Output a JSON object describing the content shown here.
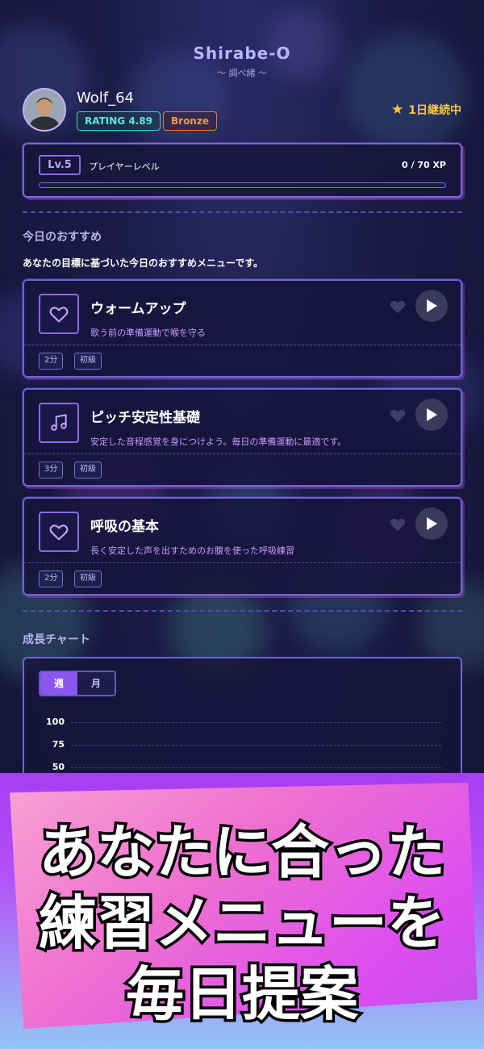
{
  "app": {
    "title": "Shirabe-O",
    "subtitle": "〜 調べ緒 〜"
  },
  "profile": {
    "avatar_icon": "user-avatar",
    "username": "Wolf_64",
    "rating": "RATING 4.89",
    "rank": "Bronze",
    "streak_icon": "star-icon",
    "streak": "1日継続中"
  },
  "level": {
    "badge": "Lv.5",
    "label": "プレイヤーレベル",
    "xp": "0 / 70 XP",
    "progress": 0
  },
  "recommend": {
    "section_title": "今日のおすすめ",
    "description": "あなたの目標に基づいた今日のおすすめメニューです。",
    "items": [
      {
        "icon": "heart-icon",
        "title": "ウォームアップ",
        "desc": "歌う前の準備運動で喉を守る",
        "duration": "2分",
        "level": "初級"
      },
      {
        "icon": "music-note-icon",
        "title": "ピッチ安定性基礎",
        "desc": "安定した音程感覚を身につけよう。毎日の準備運動に最適です。",
        "duration": "3分",
        "level": "初級"
      },
      {
        "icon": "heart-icon",
        "title": "呼吸の基本",
        "desc": "長く安定した声を出すためのお腹を使った呼吸練習",
        "duration": "2分",
        "level": "初級"
      }
    ]
  },
  "growth": {
    "section_title": "成長チャート",
    "tabs": [
      "週",
      "月"
    ],
    "active_tab": "週",
    "yticks": [
      "100",
      "75",
      "50"
    ]
  },
  "banner": {
    "lines": [
      "あなたに合った",
      "練習メニューを",
      "毎日提案"
    ]
  },
  "colors": {
    "accent": "#8b55f0",
    "rating": "#3ad6c5",
    "rank": "#e07d3a",
    "streak": "#f7c544"
  }
}
